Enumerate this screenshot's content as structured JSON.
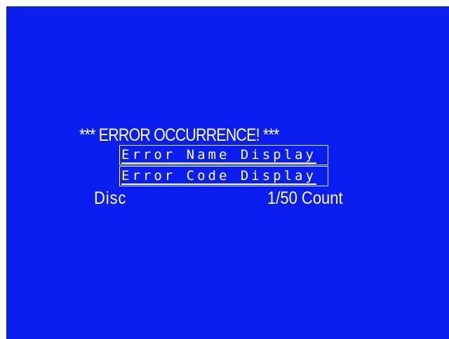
{
  "screen": {
    "background_color": "#0a1ef0",
    "text_color": "#ffffff"
  },
  "error": {
    "headline": "*** ERROR OCCURRENCE! ***",
    "name_field": "Error Name Display",
    "code_field": "Error Code Display"
  },
  "status": {
    "mode_label": "Disc",
    "count_text": "1/50 Count"
  }
}
